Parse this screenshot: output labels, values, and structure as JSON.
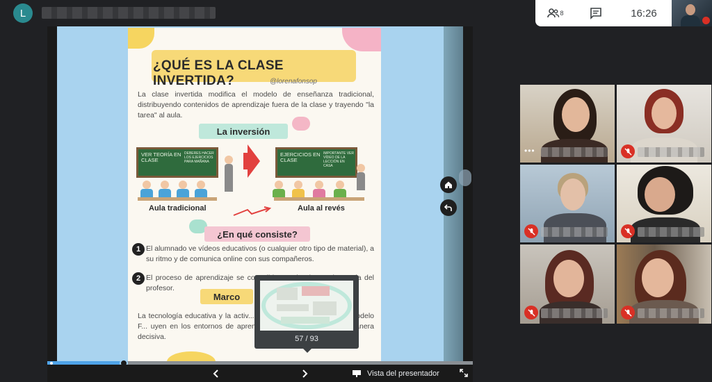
{
  "topbar": {
    "avatar_letter": "L",
    "participants_count": "8",
    "time": "16:26"
  },
  "slide": {
    "title": "¿QUÉ ES LA CLASE INVERTIDA?",
    "handle": "@lorenafonsop",
    "intro": "La clase invertida modifica el modelo de enseñanza tradicional, distribuyendo contenidos de aprendizaje fuera de la clase y trayendo \"la tarea\" al aula.",
    "section_inversion": "La inversión",
    "board_left": "VER TEORÍA EN CLASE",
    "board_left_small": "DEBERES HACER LOS EJERCICIOS PARA MAÑANA",
    "board_right": "EJERCICIOS EN CLASE",
    "board_right_small": "IMPORTANTE VER VÍDEO DE LA LECCIÓN EN CASA",
    "caption_left": "Aula tradicional",
    "caption_right": "Aula al revés",
    "section_consiste": "¿En qué consiste?",
    "point1_num": "1",
    "point1": "El alumnado ve vídeos educativos (o cualquier otro tipo de material), a su ritmo y de comunica online con sus compañeros.",
    "point2_num": "2",
    "point2": "El proceso de aprendizaje se consolida en el aula con la ayuda del profesor.",
    "section_marco": "Marco",
    "para_bottom": "La tecnología educativa y la activ... dos componentes clave del modelo F... uyen en los entornos de aprendizje del alumnado de una manera decisiva."
  },
  "preview": {
    "page_label": "57 / 93",
    "progress_fraction": 0.18
  },
  "controls": {
    "presenter_view": "Vista del presentador"
  },
  "colors": {
    "accent": "#4fa3e8",
    "mute_red": "#d93025",
    "topbar_bg": "#ffffff",
    "meet_bg": "#202124"
  }
}
